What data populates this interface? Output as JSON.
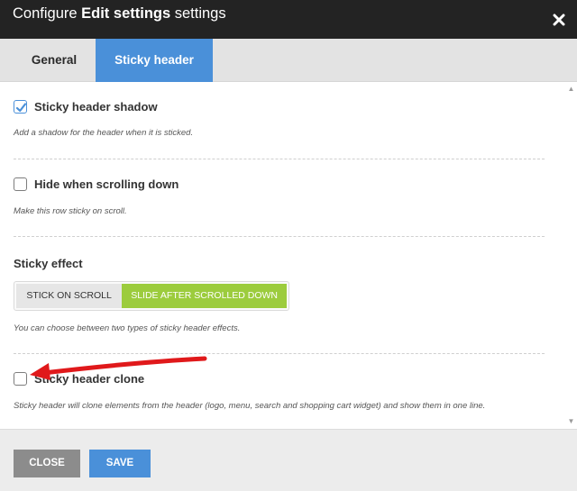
{
  "dialog": {
    "title_prefix": "Configure ",
    "title_bold": "Edit settings",
    "title_suffix": " settings",
    "close_icon": "close-icon"
  },
  "tabs": [
    {
      "label": "General",
      "active": false
    },
    {
      "label": "Sticky header",
      "active": true
    }
  ],
  "options": {
    "shadow": {
      "label": "Sticky header shadow",
      "checked": true,
      "help": "Add a shadow for the header when it is sticked."
    },
    "hide": {
      "label": "Hide when scrolling down",
      "checked": false,
      "help": "Make this row sticky on scroll."
    },
    "effect": {
      "label": "Sticky effect",
      "choices": [
        "Stick on scroll",
        "Slide after scrolled down"
      ],
      "selected": "Slide after scrolled down",
      "help": "You can choose between two types of sticky header effects."
    },
    "clone": {
      "label": "Sticky header clone",
      "checked": false,
      "help": "Sticky header will clone elements from the header (logo, menu, search and shopping cart widget) and show them in one line."
    }
  },
  "annotation": {
    "color": "#e0191b",
    "icon": "red-arrow-icon"
  },
  "footer": {
    "close_label": "CLOSE",
    "save_label": "SAVE"
  },
  "colors": {
    "accent": "#4a90d9",
    "selected_effect": "#9ccc3d",
    "titlebar": "#232323"
  }
}
